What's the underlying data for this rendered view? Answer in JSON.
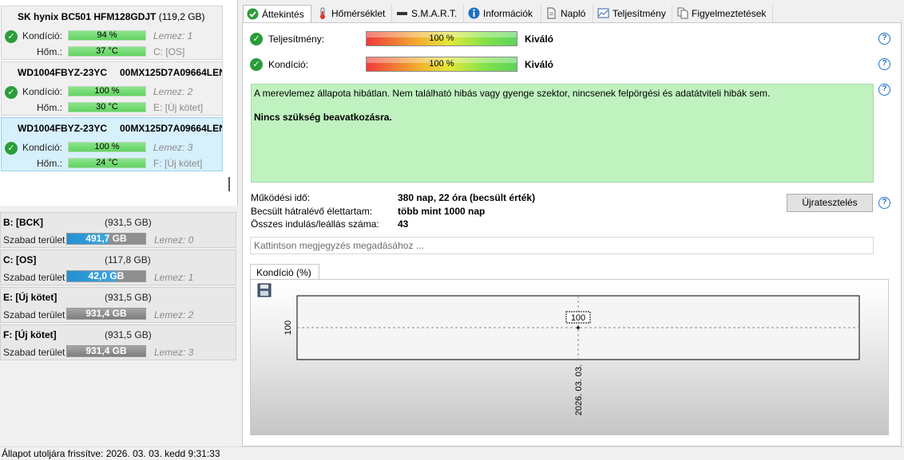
{
  "disks": [
    {
      "name": "SK hynix BC501 HFM128GDJT",
      "serial": "",
      "size": "(119,2 GB)",
      "condition_label": "Kondíció:",
      "condition": "94 %",
      "temp_label": "Hőm.:",
      "temp": "37 °C",
      "lemez": "Lemez: 1",
      "drive": "C: [OS]"
    },
    {
      "name": "WD1004FBYZ-23YC",
      "serial": "00MX125D7A09664LEN",
      "size": "",
      "condition_label": "Kondíció:",
      "condition": "100 %",
      "temp_label": "Hőm.:",
      "temp": "30 °C",
      "lemez": "Lemez: 2",
      "drive": "E: [Új kötet]"
    },
    {
      "name": "WD1004FBYZ-23YC",
      "serial": "00MX125D7A09664LEN",
      "size": "",
      "condition_label": "Kondíció:",
      "condition": "100 %",
      "temp_label": "Hőm.:",
      "temp": "24 °C",
      "lemez": "Lemez: 3",
      "drive": "F: [Új kötet]"
    }
  ],
  "volumes": [
    {
      "name": "B: [BCK]",
      "size": "(931,5 GB)",
      "free_label": "Szabad terület",
      "free": "491,7 GB",
      "lemez": "Lemez: 0",
      "fill": 0.53
    },
    {
      "name": "C: [OS]",
      "size": "(117,8 GB)",
      "free_label": "Szabad terület",
      "free": "42,0 GB",
      "lemez": "Lemez: 1",
      "fill": 0.64
    },
    {
      "name": "E: [Új kötet]",
      "size": "(931,5 GB)",
      "free_label": "Szabad terület",
      "free": "931,4 GB",
      "lemez": "Lemez: 2",
      "fill": 0.0
    },
    {
      "name": "F: [Új kötet]",
      "size": "(931,5 GB)",
      "free_label": "Szabad terület",
      "free": "931,4 GB",
      "lemez": "Lemez: 3",
      "fill": 0.0
    }
  ],
  "tabs": [
    {
      "label": "Áttekintés",
      "icon": "check-circle-icon"
    },
    {
      "label": "Hőmérséklet",
      "icon": "thermometer-icon"
    },
    {
      "label": "S.M.A.R.T.",
      "icon": "drive-icon"
    },
    {
      "label": "Információk",
      "icon": "info-icon"
    },
    {
      "label": "Napló",
      "icon": "document-icon"
    },
    {
      "label": "Teljesítmény",
      "icon": "performance-chart-icon"
    },
    {
      "label": "Figyelmeztetések",
      "icon": "warnings-icon"
    }
  ],
  "overview": {
    "performance_label": "Teljesítmény:",
    "performance_value": "100 %",
    "performance_rating": "Kiváló",
    "condition_label": "Kondíció:",
    "condition_value": "100 %",
    "condition_rating": "Kiváló",
    "status_text": "A merevlemez állapota hibátlan. Nem található hibás vagy gyenge szektor, nincsenek felpörgési és adatátviteli hibák sem.",
    "status_action": "Nincs szükség beavatkozásra.",
    "uptime_label": "Működési idő:",
    "uptime_value": "380 nap, 22 óra (becsült érték)",
    "lifetime_label": "Becsült hátralévő élettartam:",
    "lifetime_value": "több mint 1000 nap",
    "starts_label": "Összes indulás/leállás száma:",
    "starts_value": "43",
    "retest_button": "Újratesztelés",
    "note_placeholder": "Kattintson megjegyzés megadásához ...",
    "chart_tab": "Kondíció  (%)"
  },
  "status_bar": "Állapot utoljára frissítve: 2026. 03. 03. kedd 9:31:33",
  "colors": {
    "ok_green": "#2a9d3a",
    "status_bg": "#c0f2c0",
    "help_blue": "#1f6fc5",
    "free_blue": "#2590d0"
  },
  "chart_data": {
    "type": "line",
    "x": [
      "2026. 03. 03."
    ],
    "series": [
      {
        "values": [
          100
        ]
      }
    ],
    "ylabel": "",
    "ytick_labels": [
      "100"
    ],
    "data_labels": [
      "100"
    ],
    "grid": true
  }
}
